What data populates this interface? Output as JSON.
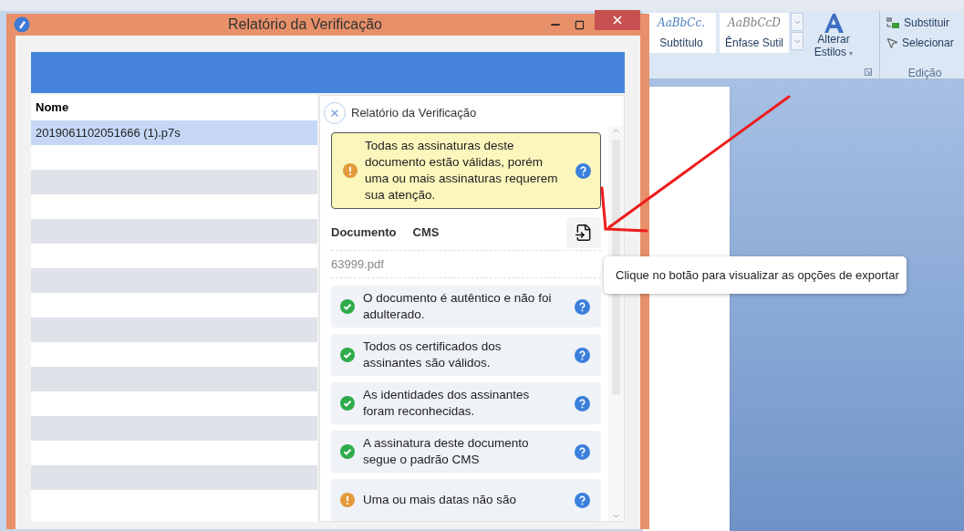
{
  "background_app": {
    "styles": [
      {
        "preview": "AaBbCc.",
        "name": "Subtítulo",
        "color": "#4f81bd"
      },
      {
        "preview": "AaBbCcD",
        "name": "Ênfase Sutil",
        "color": "#7f7f7f"
      }
    ],
    "change_styles": "Alterar Estilos",
    "styles_caret": "▾",
    "editing": {
      "items": [
        {
          "kind": "replace",
          "label": "Substituir"
        },
        {
          "kind": "select",
          "label": "Selecionar"
        }
      ],
      "group_label": "Edição"
    }
  },
  "window": {
    "title": "Relatório da Verificação"
  },
  "file_list": {
    "column": "Nome",
    "rows": [
      {
        "name": "2019061102051666 (1).p7s",
        "selected": true
      }
    ]
  },
  "report": {
    "title": "Relatório da Verificação",
    "alert": {
      "kind": "warning",
      "text": "Todas as assinaturas deste documento estão válidas, porém uma ou mais assinaturas requerem sua atenção."
    },
    "document_label": "Documento",
    "document_type": "CMS",
    "file_name": "63999.pdf",
    "checks": [
      {
        "kind": "ok",
        "text": "O documento é autêntico e não foi adulterado."
      },
      {
        "kind": "ok",
        "text": "Todos os certificados dos assinantes são válidos."
      },
      {
        "kind": "ok",
        "text": "As identidades dos assinantes foram reconhecidas."
      },
      {
        "kind": "ok",
        "text": "A assinatura deste documento segue o padrão CMS"
      },
      {
        "kind": "warning",
        "text": "Uma ou mais datas não são"
      }
    ]
  },
  "tooltip": {
    "text": "Clique no botão para visualizar as opções de exportar"
  }
}
